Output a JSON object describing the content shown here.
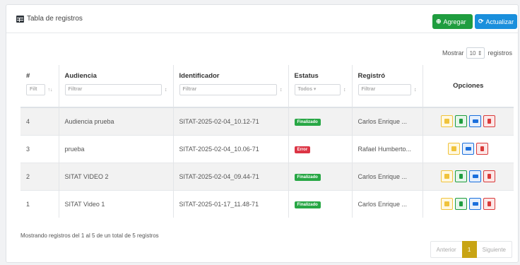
{
  "header": {
    "title": "Tabla de registros",
    "add_label": "Agregar",
    "refresh_label": "Actualizar"
  },
  "length": {
    "label_before": "Mostrar",
    "value": "10",
    "label_after": "registros"
  },
  "table": {
    "columns": [
      "#",
      "Audiencia",
      "Identificador",
      "Estatus",
      "Registró",
      "Opciones"
    ],
    "filters": {
      "id_placeholder": "Filt",
      "audiencia_placeholder": "Filtrar",
      "identificador_placeholder": "Filtrar",
      "estatus_value": "Todos",
      "registro_placeholder": "Filtrar"
    },
    "rows": [
      {
        "num": "4",
        "audiencia": "Audiencia prueba",
        "identificador": "SITAT-2025-02-04_10.12-71",
        "estatus": "Finalizado",
        "registro": "Carlos Enrique ..."
      },
      {
        "num": "3",
        "audiencia": "prueba",
        "identificador": "SITAT-2025-02-04_10.06-71",
        "estatus": "Error",
        "registro": "Rafael Humberto..."
      },
      {
        "num": "2",
        "audiencia": "SITAT VIDEO 2",
        "identificador": "SITAT-2025-02-04_09.44-71",
        "estatus": "Finalizado",
        "registro": "Carlos Enrique ..."
      },
      {
        "num": "1",
        "audiencia": "SITAT Video 1",
        "identificador": "SITAT-2025-01-17_11.48-71",
        "estatus": "Finalizado",
        "registro": "Carlos Enrique ..."
      }
    ]
  },
  "footer": {
    "info": "Mostrando registros del 1 al 5 de un total de 5 registros",
    "prev": "Anterior",
    "page": "1",
    "next": "Siguiente"
  },
  "colors": {
    "finalizado": "#28a745",
    "error": "#dc3545",
    "add": "#1f9d3f",
    "refresh": "#1a8fdc",
    "page_active": "#c8a414"
  },
  "icons": {
    "title": "table-icon",
    "add": "plus-circle-icon",
    "refresh": "refresh-icon",
    "edit": "edit-icon",
    "doc": "document-icon",
    "video": "video-icon",
    "delete": "trash-icon"
  }
}
